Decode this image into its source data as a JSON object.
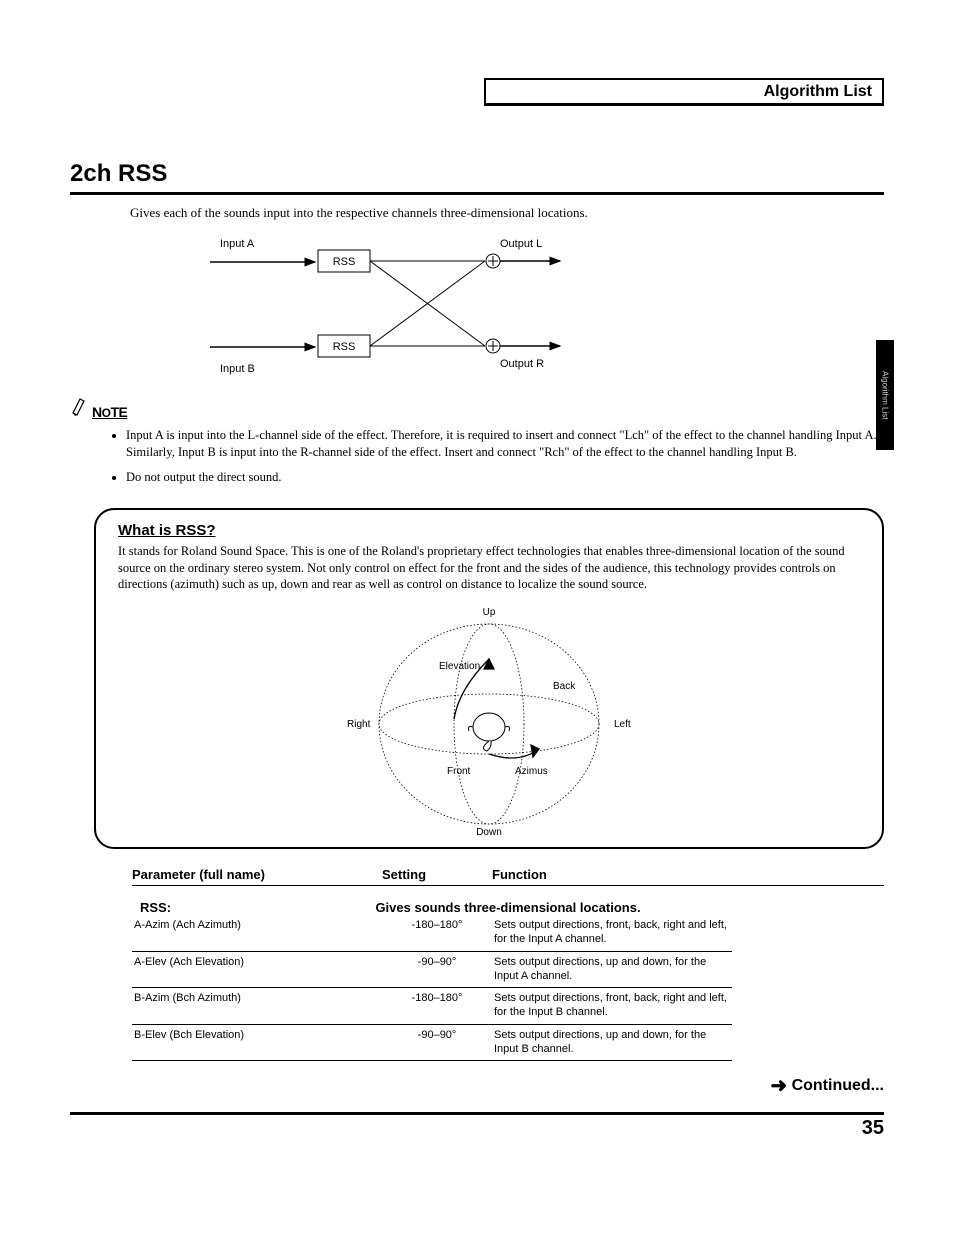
{
  "header": {
    "title": "Algorithm List"
  },
  "side_tab": "Algorithm List",
  "main": {
    "title": "2ch RSS",
    "intro": "Gives each of the sounds input into the respective channels three-dimensional locations.",
    "flow": {
      "input_a": "Input A",
      "input_b": "Input B",
      "rss": "RSS",
      "output_l": "Output L",
      "output_r": "Output R"
    },
    "note_label": "NOTE",
    "notes": [
      "Input A is input into the L-channel side of the effect. Therefore, it is required to insert and connect \"Lch\" of the effect to the channel handling Input A. Similarly, Input B is input into the R-channel side of the effect. Insert and connect \"Rch\" of the effect to the channel handling Input B.",
      "Do not output the direct sound."
    ],
    "callout": {
      "heading": "What is RSS?",
      "body": "It stands for Roland Sound Space. This is one of the Roland's proprietary effect technologies that enables three-dimensional location of the sound source on the ordinary stereo system. Not only control on effect for the front and the sides of the audience, this technology provides controls on directions (azimuth) such as up, down and rear as well as control on distance to localize the sound source.",
      "sphere_labels": {
        "up": "Up",
        "down": "Down",
        "left": "Left",
        "right": "Right",
        "front": "Front",
        "back": "Back",
        "elevation": "Elevation",
        "azimus": "Azimus"
      }
    },
    "table": {
      "headers": {
        "param": "Parameter (full name)",
        "setting": "Setting",
        "func": "Function"
      },
      "section": {
        "label": "RSS:",
        "desc": "Gives sounds three-dimensional locations."
      },
      "rows": [
        {
          "param": "A-Azim (Ach Azimuth)",
          "setting": "-180–180°",
          "func": "Sets output directions, front, back, right and left, for the Input A channel."
        },
        {
          "param": "A-Elev (Ach Elevation)",
          "setting": "-90–90°",
          "func": "Sets output directions, up and down, for the Input A channel."
        },
        {
          "param": "B-Azim (Bch Azimuth)",
          "setting": "-180–180°",
          "func": "Sets output directions, front, back, right and left, for the Input B channel."
        },
        {
          "param": "B-Elev (Bch Elevation)",
          "setting": "-90–90°",
          "func": "Sets output directions, up and down, for the Input B channel."
        }
      ]
    },
    "continued": "Continued...",
    "page_number": "35"
  }
}
